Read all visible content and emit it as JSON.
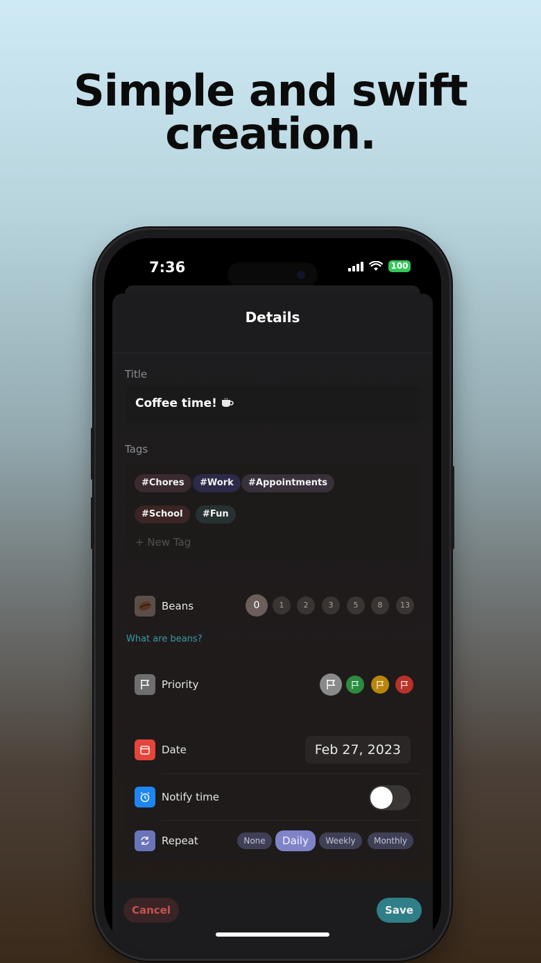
{
  "headline": {
    "line1": "Simple and swift",
    "line2": "creation."
  },
  "status_bar": {
    "time": "7:36",
    "battery": "100"
  },
  "sheet": {
    "title": "Details",
    "title_label": "Title",
    "title_value": "Coffee time!",
    "tags_label": "Tags",
    "tags": [
      "#Chores",
      "#Work",
      "#Appointments",
      "#School",
      "#Fun"
    ],
    "new_tag": "+ New Tag",
    "beans": {
      "label": "Beans",
      "options": [
        "0",
        "1",
        "2",
        "3",
        "5",
        "8",
        "13"
      ],
      "selected": "0",
      "help_link": "What are beans?"
    },
    "priority": {
      "label": "Priority",
      "colors": [
        "#9b9b9b",
        "#2e8b3e",
        "#b8860b",
        "#b8322a"
      ]
    },
    "date": {
      "label": "Date",
      "value": "Feb 27, 2023"
    },
    "notify": {
      "label": "Notify time",
      "enabled": false
    },
    "repeat": {
      "label": "Repeat",
      "options": [
        "None",
        "Daily",
        "Weekly",
        "Monthly"
      ],
      "selected": "Daily"
    },
    "cancel": "Cancel",
    "save": "Save"
  }
}
